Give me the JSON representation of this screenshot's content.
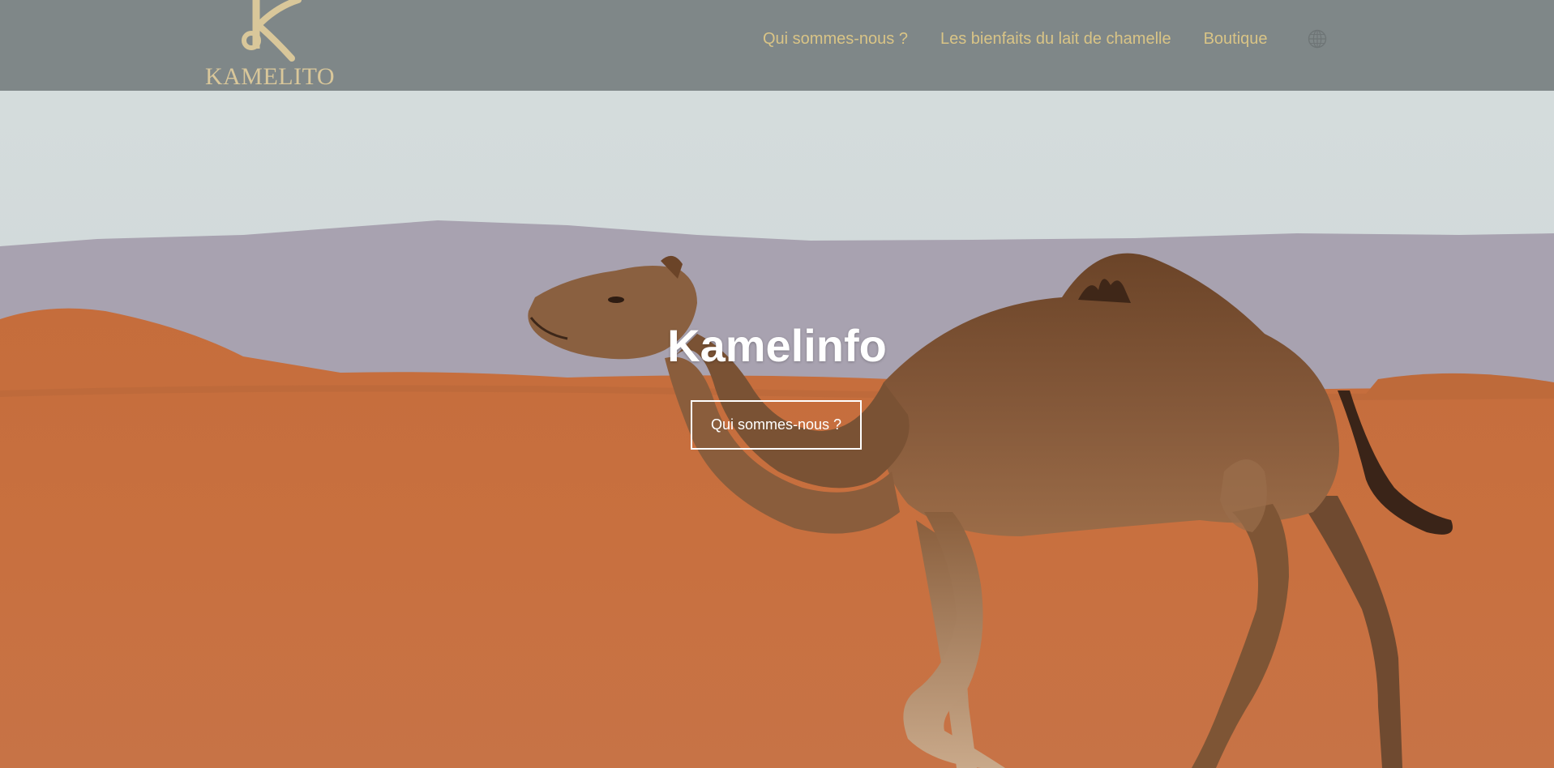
{
  "header": {
    "logo_text": "KAMELITO",
    "logo_icon": "k-monogram-logo",
    "nav": [
      {
        "label": "Qui sommes-nous ?"
      },
      {
        "label": "Les bienfaits du lait de chamelle"
      },
      {
        "label": "Boutique"
      }
    ],
    "language_icon": "globe-icon"
  },
  "hero": {
    "title": "Kamelinfo",
    "button_label": "Qui sommes-nous ?",
    "background": "camel-in-desert-photo"
  },
  "colors": {
    "header_bg": "#7f8788",
    "nav_text": "#d9c486",
    "logo": "#d9c79a",
    "hero_text": "#ffffff",
    "sand": "#c8703e",
    "sky": "#d5dddd"
  }
}
